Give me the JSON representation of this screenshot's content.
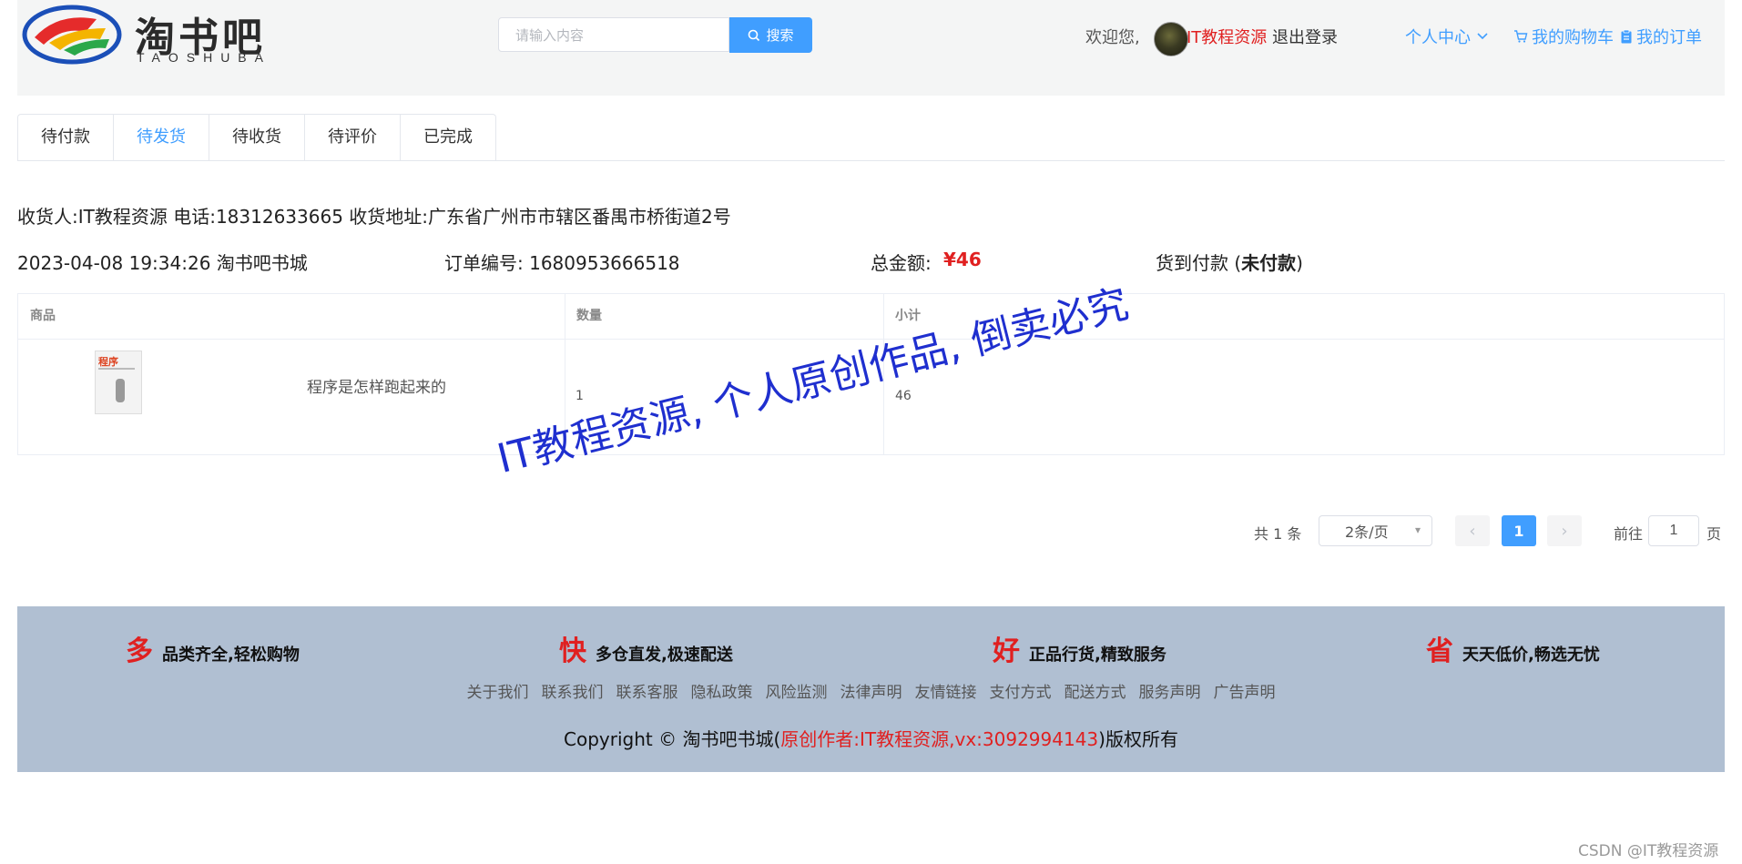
{
  "header": {
    "logo_cn": "淘书吧",
    "logo_en": "TAOSHUBA",
    "search_placeholder": "请输入内容",
    "search_label": "搜索",
    "welcome": "欢迎您,",
    "username": "IT教程资源",
    "logout": "退出登录",
    "personal_center": "个人中心",
    "cart": "我的购物车",
    "orders": "我的订单"
  },
  "tabs": [
    "待付款",
    "待发货",
    "待收货",
    "待评价",
    "已完成"
  ],
  "active_tab": 1,
  "order": {
    "receiver": "收货人:IT教程资源  电话:18312633665  收货地址:广东省广州市市辖区番禺市桥街道2号",
    "datetime_shop": "2023-04-08 19:34:26  淘书吧书城",
    "order_no": "订单编号:  1680953666518",
    "total_label": "总金额:",
    "total_value": "¥46",
    "payment_prefix": "货到付款 (",
    "payment_status": "未付款",
    "payment_suffix": ")"
  },
  "table": {
    "headers": [
      "商品",
      "数量",
      "小计"
    ],
    "rows": [
      {
        "cover_text": "程序",
        "title": "程序是怎样跑起来的",
        "quantity": "1",
        "subtotal": "46"
      }
    ]
  },
  "watermark": "IT教程资源, 个人原创作品, 倒卖必究",
  "pagination": {
    "total": "共 1 条",
    "page_size": "2条/页",
    "current": "1",
    "goto_label": "前往",
    "goto_value": "1",
    "page_label": "页"
  },
  "footer": {
    "promos": [
      {
        "big": "多",
        "text": "品类齐全,轻松购物"
      },
      {
        "big": "快",
        "text": "多仓直发,极速配送"
      },
      {
        "big": "好",
        "text": "正品行货,精致服务"
      },
      {
        "big": "省",
        "text": "天天低价,畅选无忧"
      }
    ],
    "links": [
      "关于我们",
      "联系我们",
      "联系客服",
      "隐私政策",
      "风险监测",
      "法律声明",
      "友情链接",
      "支付方式",
      "配送方式",
      "服务声明",
      "广告声明"
    ],
    "copyright_prefix": "Copyright © 淘书吧书城(",
    "copyright_author": "原创作者:IT教程资源,vx:3092994143",
    "copyright_suffix": ")版权所有"
  },
  "csdn": "CSDN @IT教程资源",
  "colors": {
    "accent": "#409eff",
    "price": "#e02020",
    "footer_bg": "#b0bfd2"
  }
}
